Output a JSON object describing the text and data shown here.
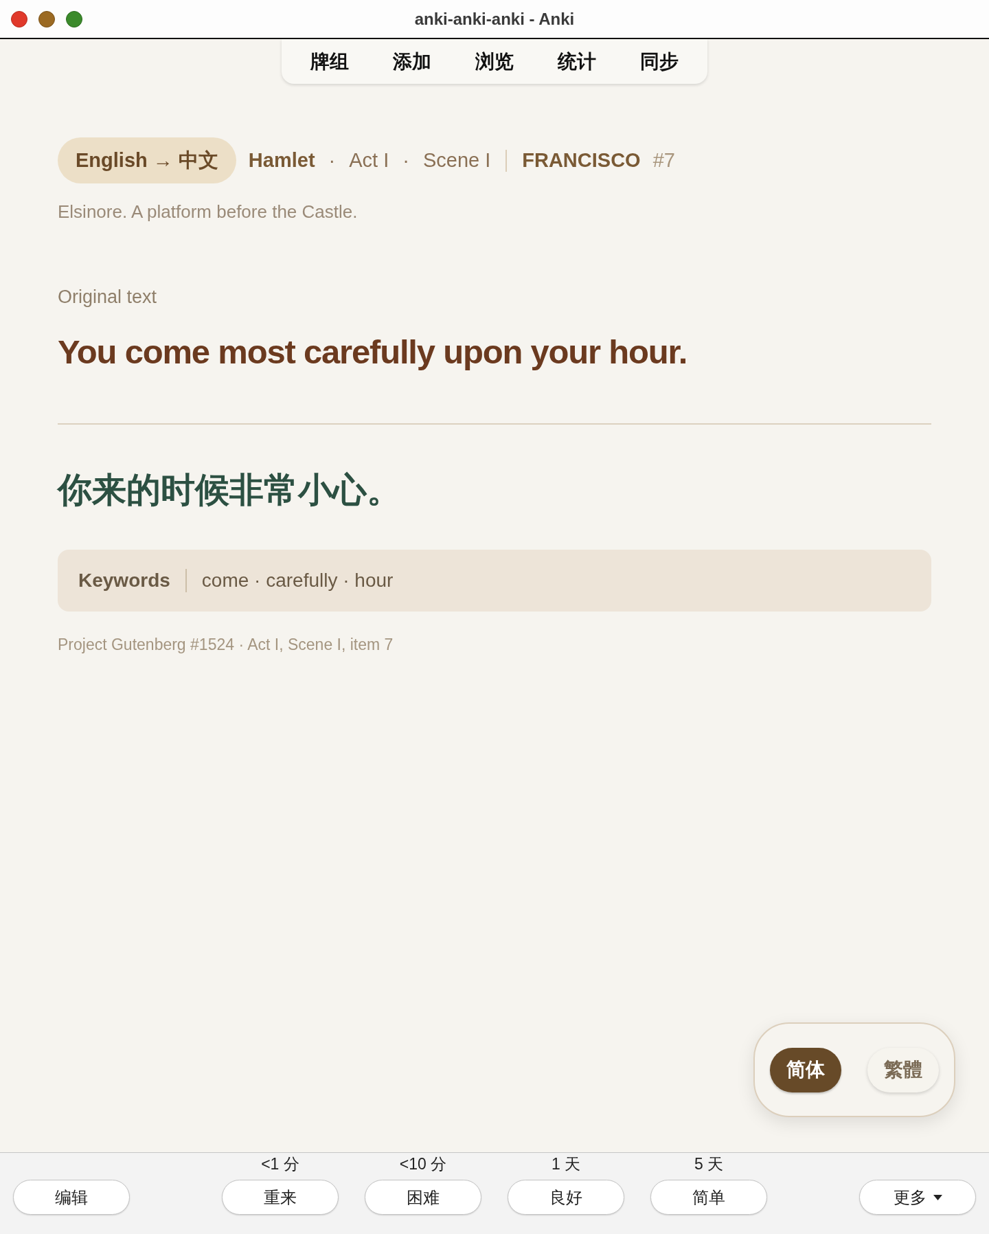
{
  "window": {
    "title": "anki-anki-anki - Anki"
  },
  "toolbar": [
    {
      "label": "牌组"
    },
    {
      "label": "添加"
    },
    {
      "label": "浏览"
    },
    {
      "label": "统计"
    },
    {
      "label": "同步"
    }
  ],
  "card": {
    "direction": "English → 中文",
    "breadcrumb": [
      {
        "kind": "title",
        "text": "Hamlet"
      },
      {
        "kind": "dot",
        "text": "·"
      },
      {
        "kind": "plain",
        "text": "Act I"
      },
      {
        "kind": "dot",
        "text": "·"
      },
      {
        "kind": "plain",
        "text": "Scene I"
      },
      {
        "kind": "rule"
      },
      {
        "kind": "speaker",
        "text": "FRANCISCO"
      },
      {
        "kind": "number",
        "text": "#7"
      }
    ],
    "setting": "Elsinore. A platform before the Castle.",
    "original_label": "Original text",
    "original": "You come most carefully upon your hour.",
    "translation": "你来的时候非常小心。",
    "keywords": {
      "label": "Keywords",
      "words": "come · carefully · hour"
    },
    "source": "Project Gutenberg #1524 · Act I, Scene I, item 7"
  },
  "script_toggle": [
    {
      "label": "简体",
      "selected": true
    },
    {
      "label": "繁體",
      "selected": false
    }
  ],
  "review_bar": {
    "edit": "编辑",
    "answers": [
      {
        "interval": "<1 分",
        "label": "重来"
      },
      {
        "interval": "<10 分",
        "label": "困难"
      },
      {
        "interval": "1 天",
        "label": "良好"
      },
      {
        "interval": "5 天",
        "label": "简单"
      }
    ],
    "more": "更多"
  }
}
